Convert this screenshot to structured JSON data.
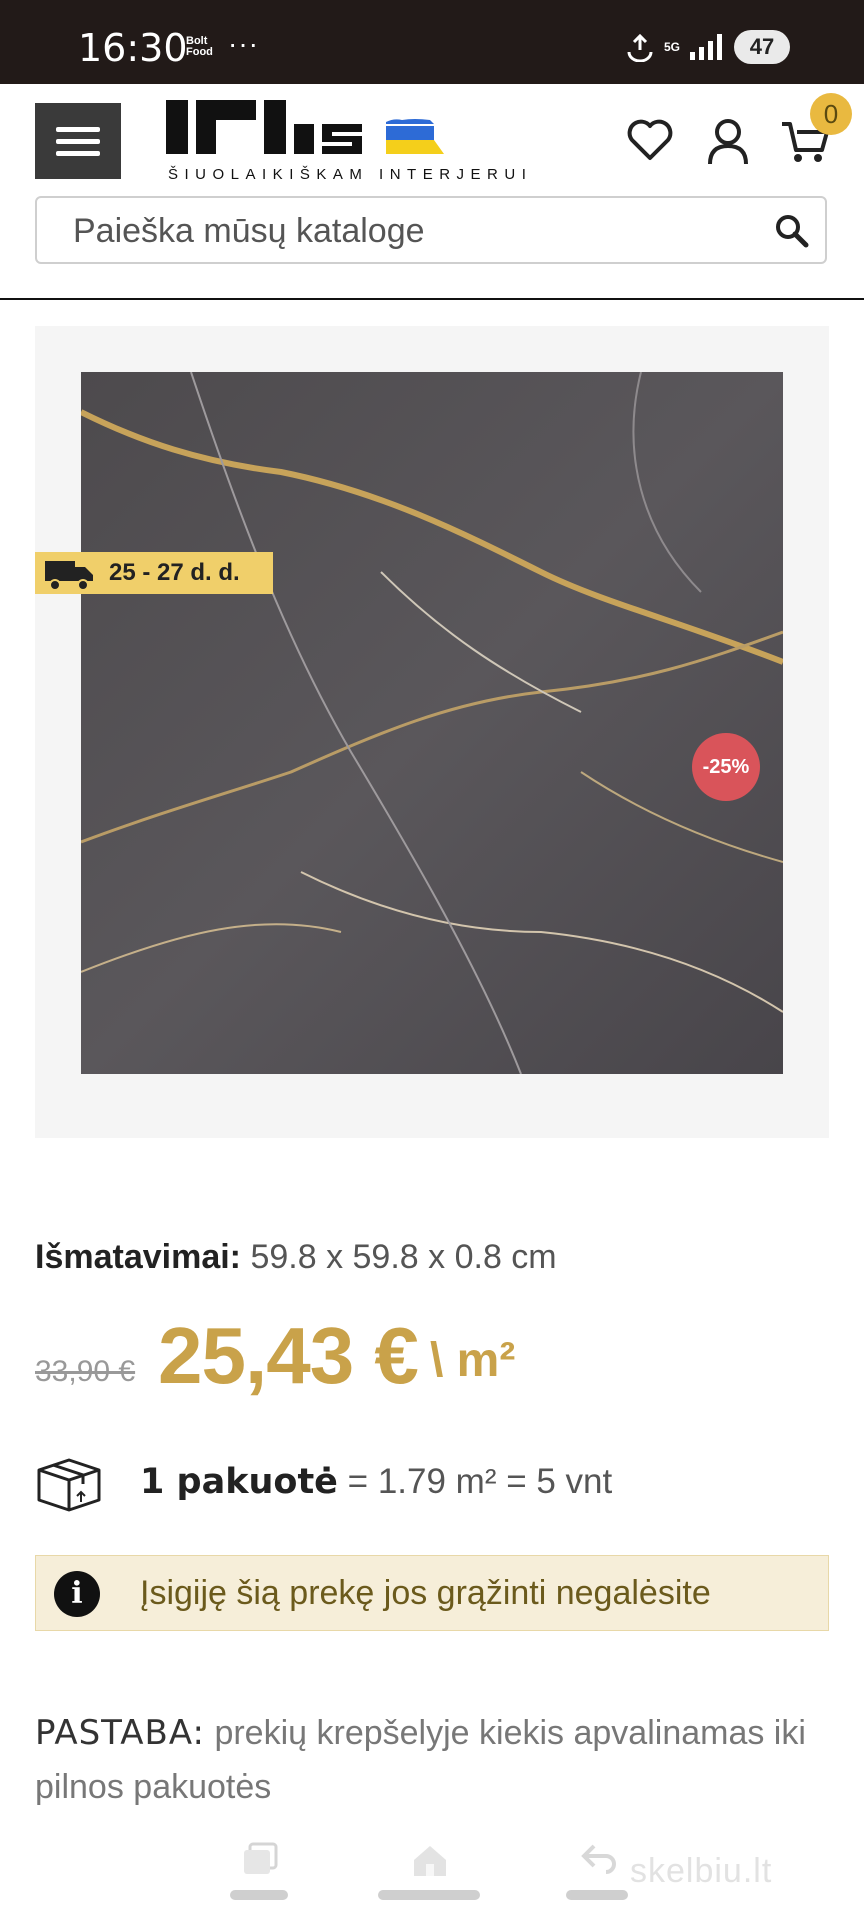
{
  "status_bar": {
    "time": "16:30",
    "app_badge": "Bolt Food",
    "more": "···",
    "network": "5G",
    "battery": "47"
  },
  "header": {
    "logo_text": "IRIS",
    "tagline": "ŠIUOLAIKIŠKAM INTERJERUI",
    "cart_count": "0",
    "icons": [
      "menu-icon",
      "heart-icon",
      "user-icon",
      "cart-icon"
    ]
  },
  "search": {
    "placeholder": "Paieška mūsų kataloge"
  },
  "product": {
    "delivery_badge": "25 - 27 d. d.",
    "discount_badge": "-25%",
    "dimensions_label": "Išmatavimai:",
    "dimensions_value": "59.8 x 59.8 x 0.8 cm",
    "old_price": "33,90 €",
    "price": "25,43 €",
    "unit": "\\ m²",
    "package_label": "1 pakuotė",
    "package_value": "= 1.79 m² = 5 vnt",
    "notice": "Įsigiję šią prekę jos grąžinti negalėsite",
    "note_label": "PASTABA:",
    "note_text": "prekių krepšelyje kiekis apvalinamas iki pilnos pakuotės"
  },
  "overlay": {
    "watermark": "skelbiu.lt"
  },
  "colors": {
    "accent_gold": "#c9a24a",
    "badge_yellow": "#f0cf6a",
    "discount_red": "#d9545a",
    "status_bar": "#221a18"
  }
}
